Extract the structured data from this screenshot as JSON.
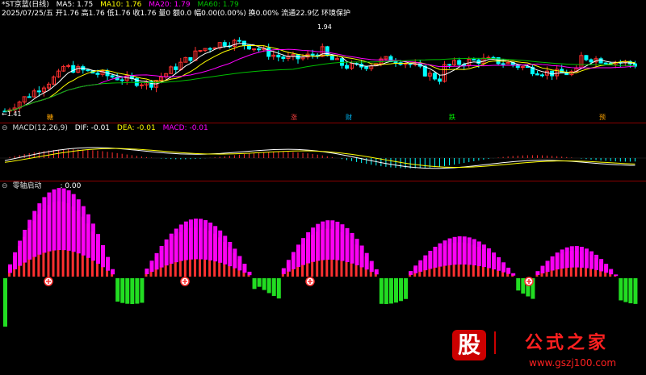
{
  "header1": {
    "stock": "*ST京蓝(日线)",
    "ma5": "MA5: 1.75",
    "ma10": "MA10: 1.76",
    "ma20": "MA20: 1.79",
    "ma60": "MA60: 1.79",
    "line2": "2025/07/25/五 开1.76 高1.76 低1.76 收1.76 量0 额0.0 幅0.00(0.00%) 换0.00% 流通22.9亿 环境保护"
  },
  "price_pane": {
    "high_label": "1.94",
    "low_label": "←1.41",
    "events": [
      "糖",
      "涨",
      "财",
      "跌",
      "预"
    ]
  },
  "macd": {
    "title": "MACD(12,26,9)",
    "dif": "DIF: -0.01",
    "dea": "DEA: -0.01",
    "macd": "MACD: -0.01"
  },
  "ind3": {
    "title": "零轴启动",
    "value": ": 0.00"
  },
  "watermark": {
    "logo_char": "股",
    "brand": "公式之家",
    "url": "www.gszj100.com"
  },
  "colors": {
    "ma5": "#ffffff",
    "ma10": "#ffff00",
    "ma20": "#ff00ff",
    "ma60": "#00c000",
    "up": "#ff3030",
    "down": "#00ffff",
    "pos": "#ff00ff",
    "neg": "#22dd22"
  }
}
